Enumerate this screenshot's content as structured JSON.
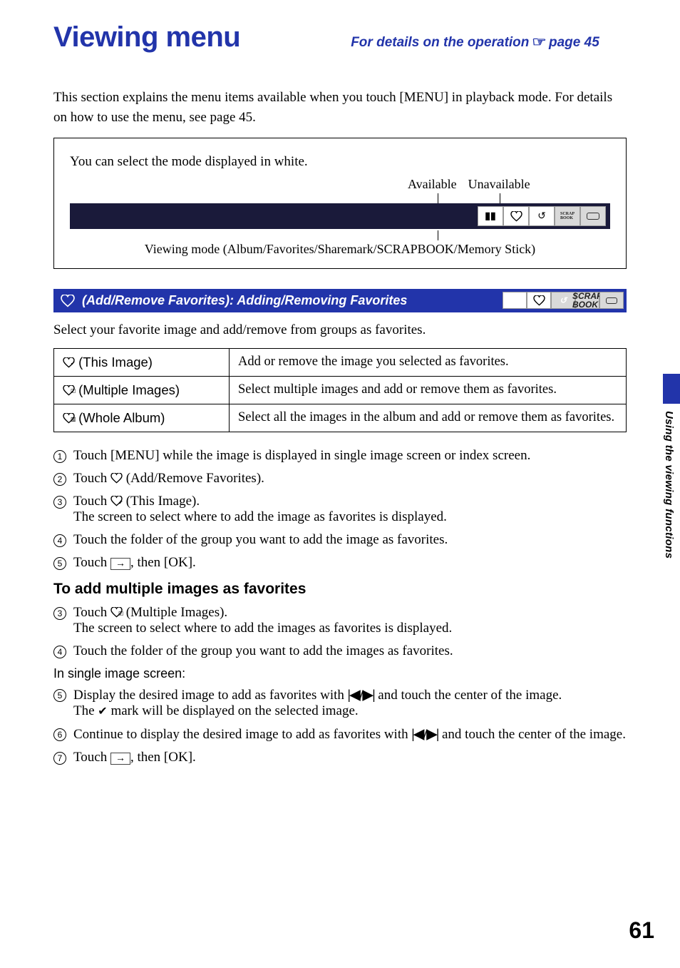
{
  "header": {
    "title": "Viewing menu",
    "subtitle_prefix": "For details on the operation ",
    "pointer_icon": "☞",
    "subtitle_suffix": " page 45"
  },
  "intro": "This section explains the menu items available when you touch [MENU] in playback mode. For details on how to use the menu, see page 45.",
  "mode_box": {
    "note": "You can select the mode displayed in white.",
    "available_label": "Available",
    "unavailable_label": "Unavailable",
    "icons": {
      "album": "▮▮",
      "heart": "♡",
      "share": "↻",
      "scrap": "SCRAP BOOK",
      "stick": "▭"
    },
    "caption": "Viewing mode (Album/Favorites/Sharemark/SCRAPBOOK/Memory Stick)"
  },
  "section": {
    "title": " (Add/Remove Favorites): Adding/Removing Favorites"
  },
  "lead": "Select your favorite image and add/remove from groups as favorites.",
  "table": {
    "rows": [
      {
        "label": " (This Image)",
        "desc": "Add or remove the image you selected as favorites."
      },
      {
        "label": " (Multiple Images)",
        "desc": "Select multiple images and add or remove them as favorites."
      },
      {
        "label": " (Whole Album)",
        "desc": "Select all the images in the album and add or remove them as favorites."
      }
    ]
  },
  "steps_main": [
    {
      "n": "1",
      "text": "Touch [MENU] while the image is displayed in single image screen or index screen."
    },
    {
      "n": "2",
      "pre": "Touch ",
      "icon": "heart",
      "post": " (Add/Remove Favorites)."
    },
    {
      "n": "3",
      "pre": "Touch ",
      "icon": "heart-this",
      "mid": " (This Image).",
      "sub": "The screen to select where to add the image as favorites is displayed."
    },
    {
      "n": "4",
      "text": "Touch the folder of the group you want to add the image as favorites."
    },
    {
      "n": "5",
      "pre": "Touch ",
      "arrow": "→",
      "post": ", then [OK]."
    }
  ],
  "multi_head": "To add multiple images as favorites",
  "steps_multi": [
    {
      "n": "3",
      "pre": "Touch ",
      "icon": "heart-multi",
      "mid": " (Multiple Images).",
      "sub": "The screen to select where to add the images as favorites is displayed."
    },
    {
      "n": "4",
      "text": "Touch the folder of the group you want to add the images as favorites."
    }
  ],
  "single_screen_label": "In single image screen:",
  "steps_single": [
    {
      "n": "5",
      "pre": "Display the desired image to add as favorites with ",
      "nav": "|◀/▶|",
      "post": " and touch the center of the image.",
      "sub_pre": "The ",
      "check": "✔",
      "sub_post": " mark will be displayed on the selected image."
    },
    {
      "n": "6",
      "pre": "Continue to display the desired image to add as favorites with ",
      "nav": "|◀/▶|",
      "post": " and touch the center of the image."
    },
    {
      "n": "7",
      "pre": "Touch ",
      "arrow": "→",
      "post": ", then [OK]."
    }
  ],
  "side": {
    "label": "Using the viewing functions"
  },
  "page_number": "61"
}
